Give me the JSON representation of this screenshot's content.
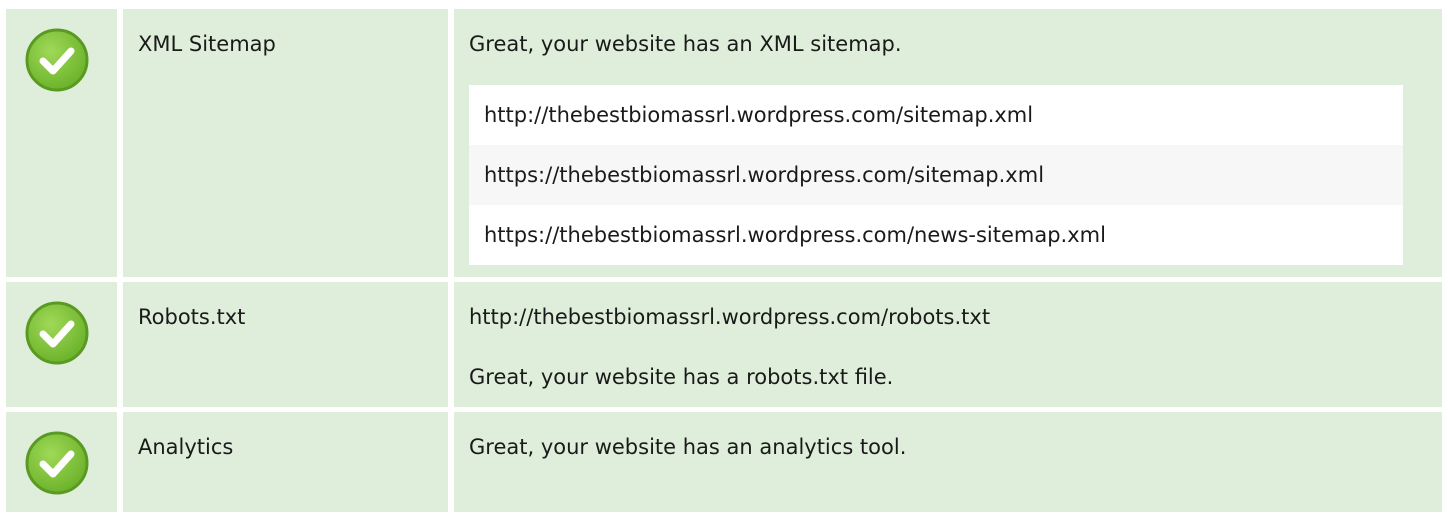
{
  "rows": [
    {
      "label": "XML Sitemap",
      "message": "Great, your website has an XML sitemap.",
      "urls": [
        "http://thebestbiomassrl.wordpress.com/sitemap.xml",
        "https://thebestbiomassrl.wordpress.com/sitemap.xml",
        "https://thebestbiomassrl.wordpress.com/news-sitemap.xml"
      ]
    },
    {
      "label": "Robots.txt",
      "url": "http://thebestbiomassrl.wordpress.com/robots.txt",
      "message": "Great, your website has a robots.txt file."
    },
    {
      "label": "Analytics",
      "message": "Great, your website has an analytics tool."
    }
  ],
  "icons": {
    "status": "check-circle-icon"
  },
  "colors": {
    "row_background": "#dfeedb",
    "check_green": "#7ec23c",
    "check_ring": "#5a9a22"
  }
}
